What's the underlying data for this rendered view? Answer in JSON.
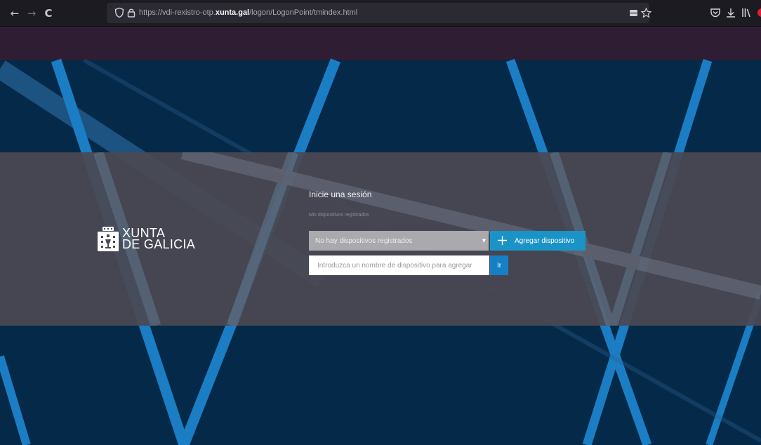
{
  "browser": {
    "url": {
      "prefix": "https://vdi-rexistro-otp.",
      "domain": "xunta.gal",
      "path": "/logon/LogonPoint/tmindex.html"
    },
    "nav_icons": [
      "back-arrow-icon",
      "forward-arrow-icon",
      "reload-icon"
    ],
    "glyphs": {
      "back": "←",
      "forward": "→",
      "reload": "C"
    }
  },
  "logo": {
    "line1": "XUNTA",
    "line2": "DE GALICIA"
  },
  "login": {
    "title": "Inicie una sesión",
    "devices_label": "Mis dispositivos registrados",
    "device_select_value": "No hay dispositivos registrados",
    "device_select_caret": "▼",
    "add_device_label": "Agregar dispositivo",
    "device_name_placeholder": "Introduzca un nombre de dispositivo para agregar",
    "go_label": "Ir"
  },
  "colors": {
    "chrome_bg": "#1c1b22",
    "page_bg": "#052a49",
    "top_band": "#2e1d33",
    "panel_band": "#4a4852",
    "accent_button": "#1a93c7",
    "go_button": "#1580c4",
    "stripe_blue": "#1b7dc4"
  }
}
